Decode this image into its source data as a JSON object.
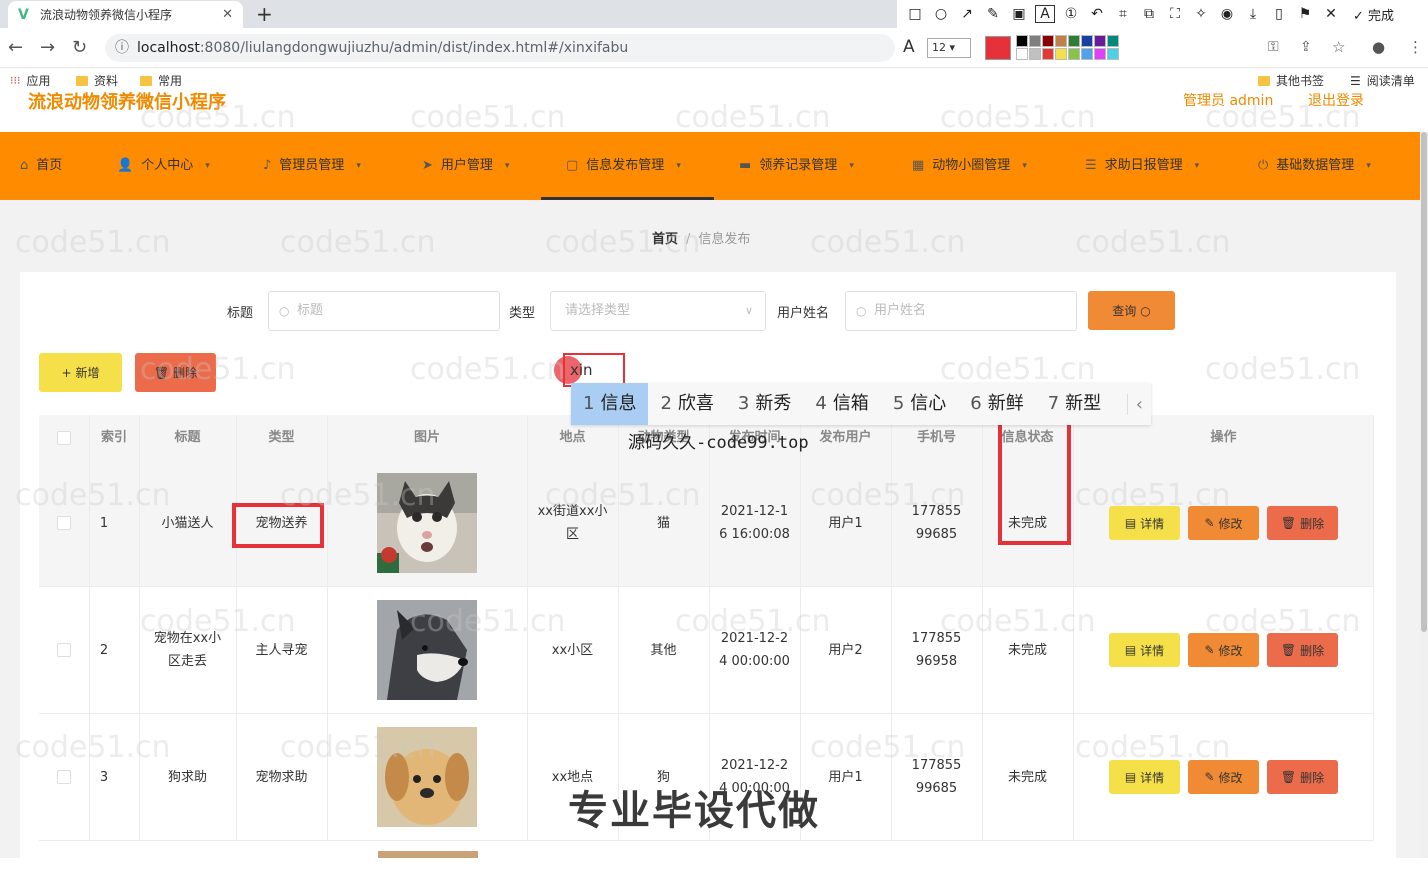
{
  "browser": {
    "tab_title": "流浪动物领养微信小程序",
    "url_host": "localhost",
    "url_path": ":8080/liulangdongwujiuzhu/admin/dist/index.html#/xinxifabu",
    "bookmarks": [
      "应用",
      "资料",
      "常用"
    ],
    "bookmarks_right": [
      "其他书签",
      "阅读清单"
    ],
    "annot_done": "完成",
    "annot_font_size": "12"
  },
  "app": {
    "title": "流浪动物领养微信小程序",
    "admin_label": "管理员 admin",
    "logout_label": "退出登录"
  },
  "menu": [
    {
      "label": "首页",
      "icon": "home-icon"
    },
    {
      "label": "个人中心",
      "icon": "user-icon"
    },
    {
      "label": "管理员管理",
      "icon": "mic-icon"
    },
    {
      "label": "用户管理",
      "icon": "send-icon"
    },
    {
      "label": "信息发布管理",
      "icon": "doc-icon"
    },
    {
      "label": "领养记录管理",
      "icon": "chat-icon"
    },
    {
      "label": "动物小圈管理",
      "icon": "table-icon"
    },
    {
      "label": "求助日报管理",
      "icon": "list-icon"
    },
    {
      "label": "基础数据管理",
      "icon": "power-icon"
    }
  ],
  "breadcrumb": {
    "home": "首页",
    "current": "信息发布"
  },
  "filters": {
    "title_label": "标题",
    "title_placeholder": "标题",
    "type_label": "类型",
    "type_placeholder": "请选择类型",
    "user_label": "用户姓名",
    "user_placeholder": "用户姓名",
    "query_label": "查询"
  },
  "actions": {
    "add_label": "新增",
    "delete_label": "删除"
  },
  "table": {
    "headers": [
      "索引",
      "标题",
      "类型",
      "图片",
      "地点",
      "动物类型",
      "发布时间",
      "发布用户",
      "手机号",
      "信息状态",
      "操作"
    ],
    "op_labels": {
      "detail": "详情",
      "edit": "修改",
      "delete": "删除"
    },
    "rows": [
      {
        "index": "1",
        "title": "小猫送人",
        "type": "宠物送养",
        "location": "xx街道xx小区",
        "animal": "猫",
        "time": "2021-12-16 16:00:08",
        "user": "用户1",
        "phone": "17785599685",
        "status": "未完成",
        "pic": "cat"
      },
      {
        "index": "2",
        "title": "宠物在xx小区走丢",
        "type": "主人寻宠",
        "location": "xx小区",
        "animal": "其他",
        "time": "2021-12-24 00:00:00",
        "user": "用户2",
        "phone": "17785596958",
        "status": "未完成",
        "pic": "husky"
      },
      {
        "index": "3",
        "title": "狗求助",
        "type": "宠物求助",
        "location": "xx地点",
        "animal": "狗",
        "time": "2021-12-24 00:00:00",
        "user": "用户1",
        "phone": "17785599685",
        "status": "未完成",
        "pic": "puppy"
      }
    ]
  },
  "ime": {
    "typed": "xin",
    "candidates": [
      {
        "n": "1",
        "text": "信息"
      },
      {
        "n": "2",
        "text": "欣喜"
      },
      {
        "n": "3",
        "text": "新秀"
      },
      {
        "n": "4",
        "text": "信箱"
      },
      {
        "n": "5",
        "text": "信心"
      },
      {
        "n": "6",
        "text": "新鲜"
      },
      {
        "n": "7",
        "text": "新型"
      }
    ]
  },
  "overlays": {
    "source_text": "源码久久-code99.top",
    "promo_text": "专业毕设代做",
    "watermark": "code51.cn"
  },
  "colors": {
    "menu_bg": "#ff8c00",
    "accent": "#f08a00",
    "annot_red": "#e5323a"
  }
}
